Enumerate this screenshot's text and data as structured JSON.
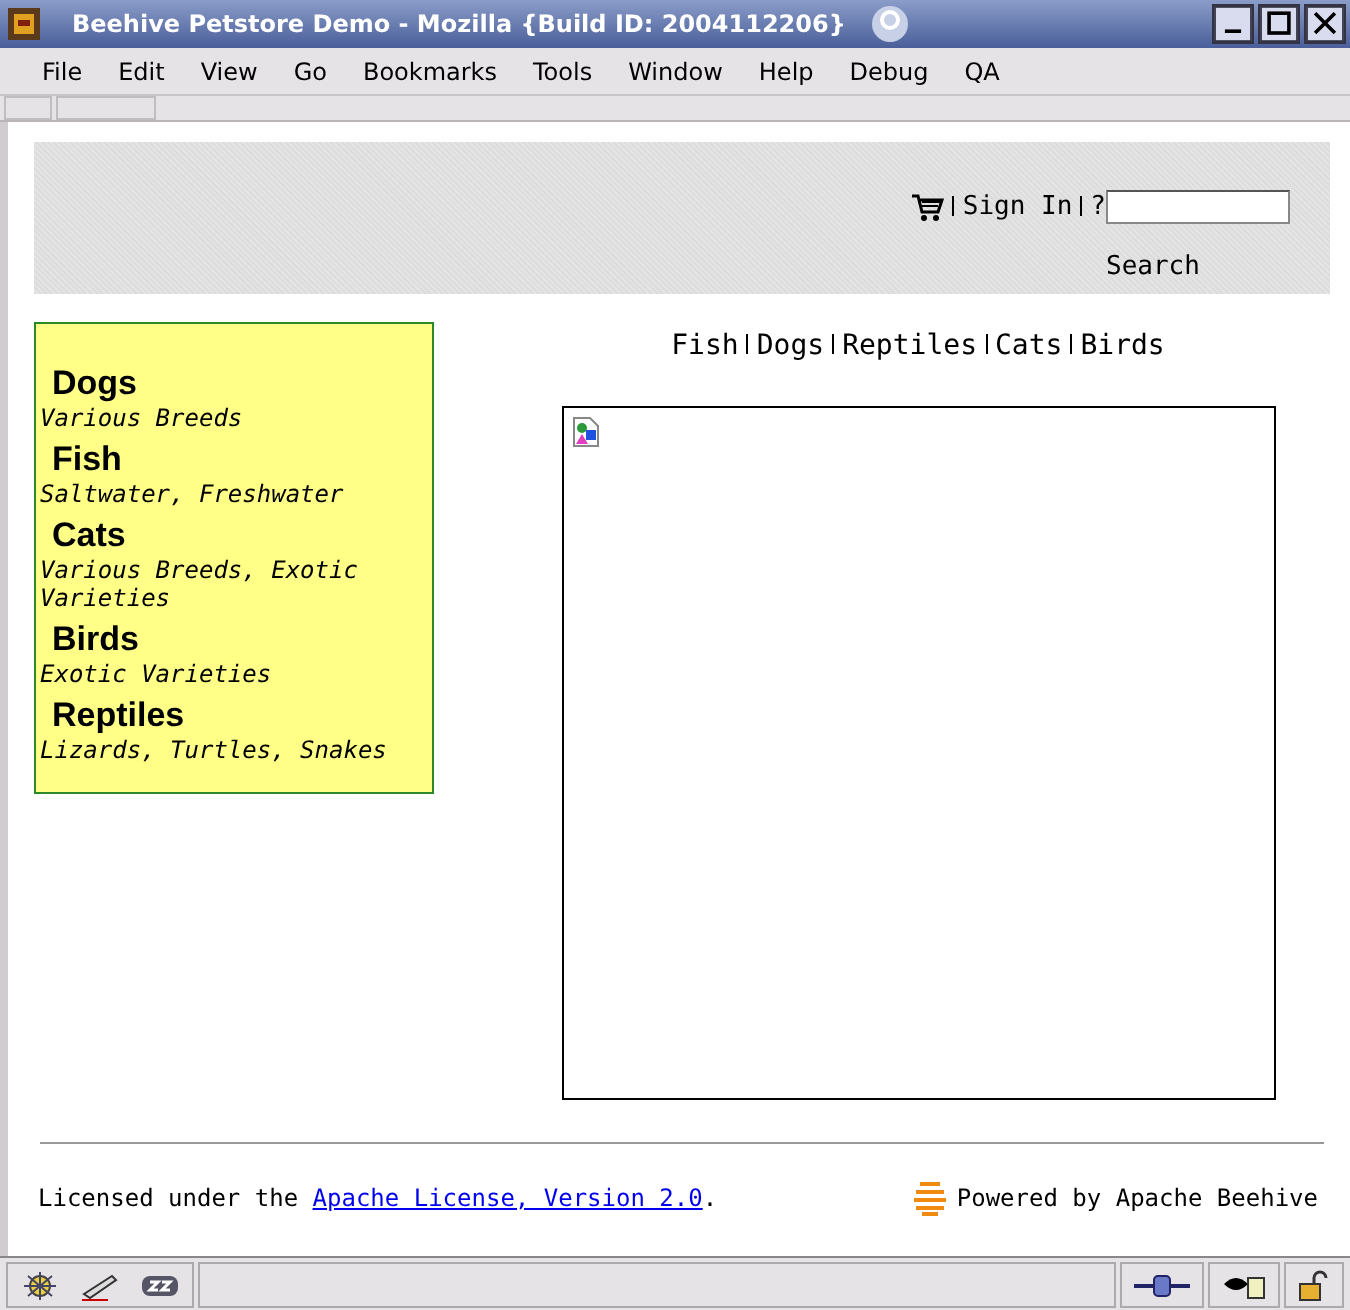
{
  "window": {
    "title": "Beehive Petstore Demo - Mozilla {Build ID: 2004112206}"
  },
  "menu": [
    "File",
    "Edit",
    "View",
    "Go",
    "Bookmarks",
    "Tools",
    "Window",
    "Help",
    "Debug",
    "QA"
  ],
  "header": {
    "sign_in": "Sign In",
    "help": "?",
    "search_button": "Search"
  },
  "nav": [
    "Fish",
    "Dogs",
    "Reptiles",
    "Cats",
    "Birds"
  ],
  "sidebar": [
    {
      "name": "Dogs",
      "description": "Various Breeds"
    },
    {
      "name": "Fish",
      "description": "Saltwater, Freshwater"
    },
    {
      "name": "Cats",
      "description": "Various Breeds, Exotic Varieties"
    },
    {
      "name": "Birds",
      "description": "Exotic Varieties"
    },
    {
      "name": "Reptiles",
      "description": "Lizards, Turtles, Snakes"
    }
  ],
  "footer": {
    "license_prefix": "Licensed under the ",
    "license_link": "Apache License, Version 2.0",
    "license_suffix": ".",
    "powered": "Powered by Apache Beehive"
  }
}
